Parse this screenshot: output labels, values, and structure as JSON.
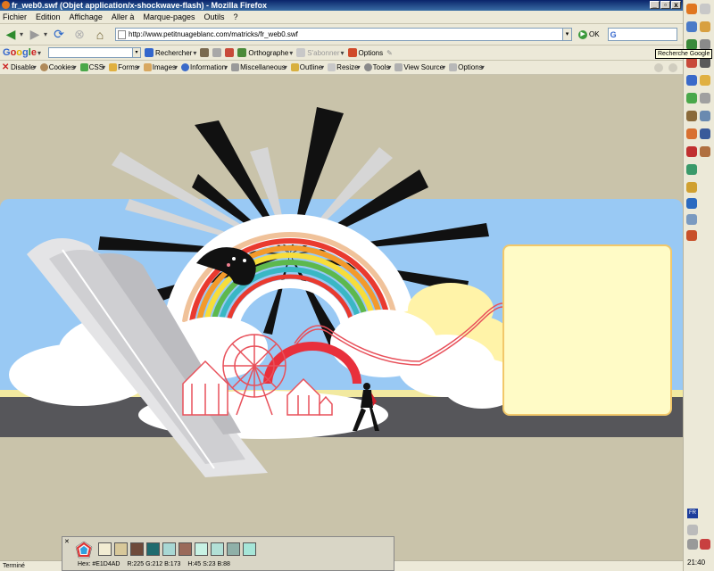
{
  "window": {
    "title": "fr_web0.swf (Objet application/x-shockwave-flash) - Mozilla Firefox",
    "buttons": [
      "_",
      "▫",
      "x"
    ]
  },
  "menu": [
    "Fichier",
    "Edition",
    "Affichage",
    "Aller à",
    "Marque-pages",
    "Outils",
    "?"
  ],
  "navigation": {
    "url": "http://www.petitnuageblanc.com/matricks/fr_web0.swf",
    "go_label": "OK"
  },
  "google_toolbar": {
    "logo": "Google",
    "search_label": "Rechercher",
    "spell_label": "Orthographe",
    "subscribe_label": "S'abonner",
    "options_label": "Options",
    "tooltip": "Recherche Google"
  },
  "dev_toolbar": [
    "Disable",
    "Cookies",
    "CSS",
    "Forms",
    "Images",
    "Information",
    "Miscellaneous",
    "Outline",
    "Resize",
    "Tools",
    "View Source",
    "Options"
  ],
  "status": {
    "text": "Terminé"
  },
  "color_picker": {
    "hex_label": "Hex: #E1D4AD",
    "rgb_label": "R:225  G:212  B:173",
    "hsb_label": "H:45  S:23  B:88",
    "swatches": [
      "#f2ecd2",
      "#d8c89a",
      "#6e4a3a",
      "#1f6b6e",
      "#a8d8d4",
      "#9a6a5a",
      "#c8f2e4",
      "#b2e0d6",
      "#8fb0a8",
      "#a6e6d8"
    ]
  },
  "sidebar": {
    "lang": "FR",
    "clock": "21:40"
  },
  "colors": {
    "page_background": "#c9c3aa",
    "sky": "#99c9f4",
    "panel_fill": "#fffbc6",
    "panel_border": "#f2c86a"
  }
}
